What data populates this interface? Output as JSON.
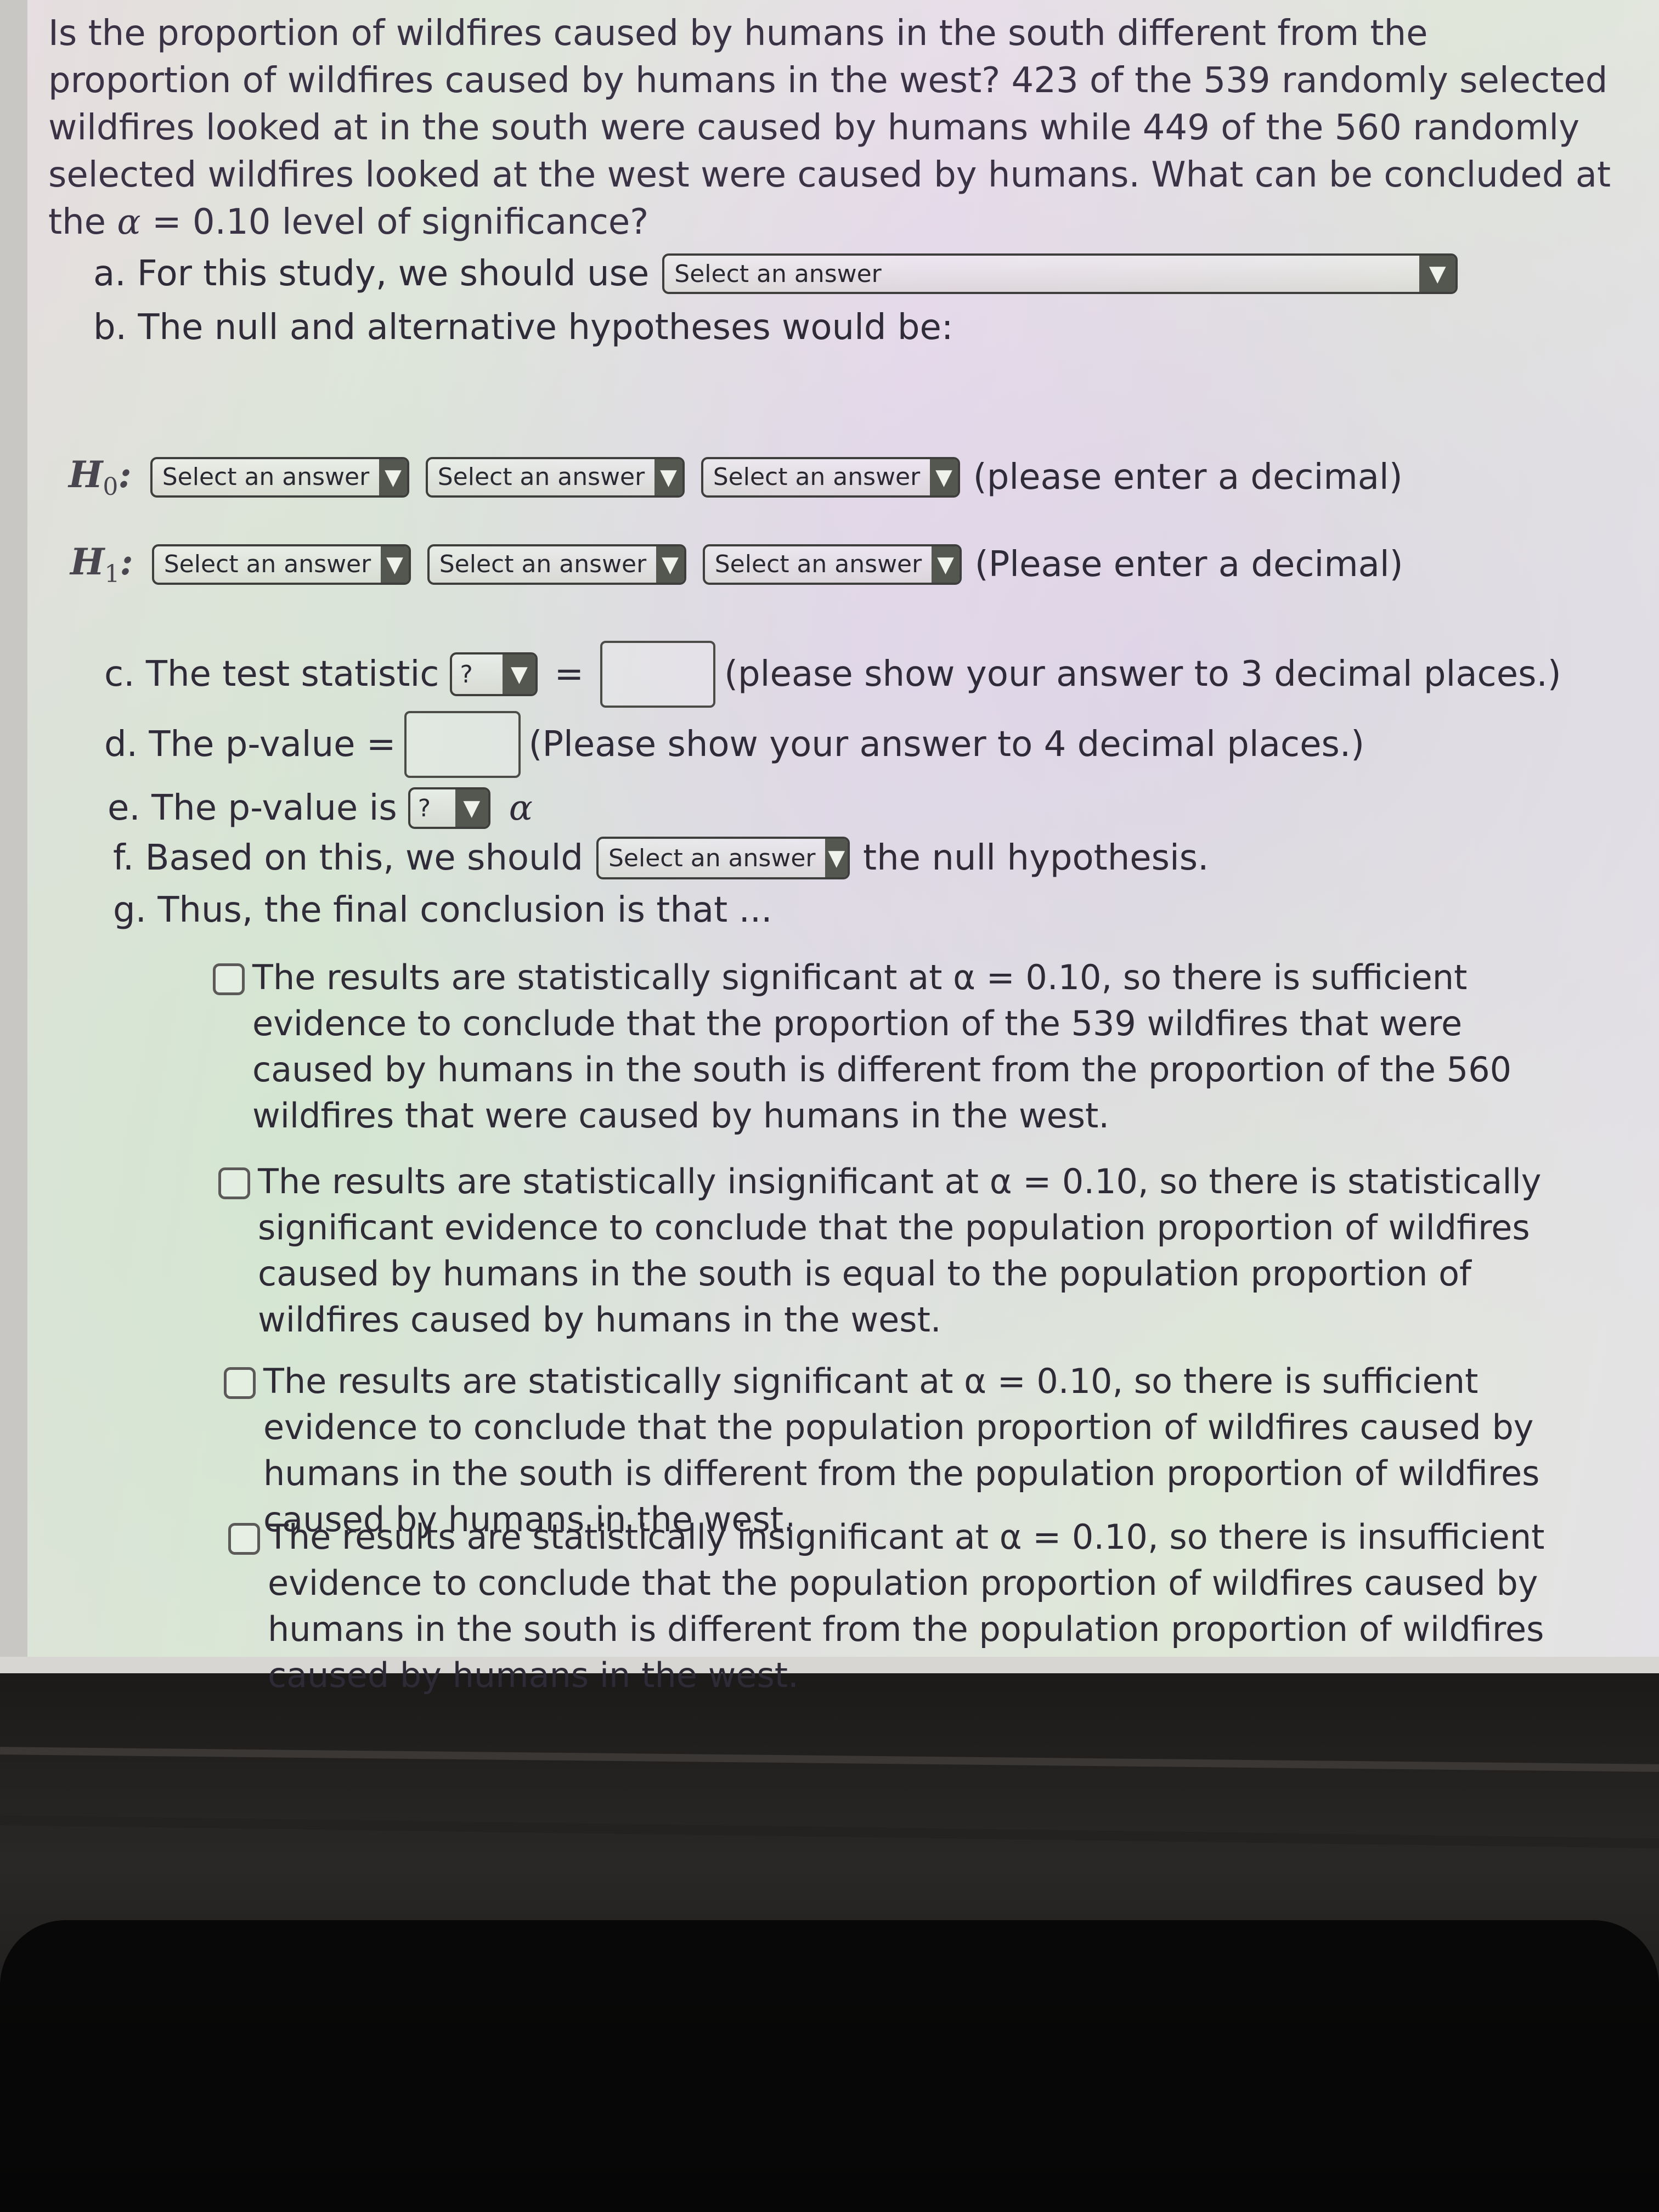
{
  "question": {
    "text_before_alpha": "Is the proportion of wildfires caused by humans in the south different from the proportion of wildfires caused by humans in the west? 423 of the 539 randomly selected wildfires looked at in the south were caused by humans while 449 of the 560 randomly selected wildfires looked at the west were caused by humans. What can be concluded at the ",
    "alpha_symbol": "α",
    "text_after_alpha": " = 0.10 level of significance?"
  },
  "part_a": {
    "label": "a.  For this study, we should use",
    "select": "Select an answer",
    "arrow": "▼"
  },
  "part_b": {
    "label": "b.  The null and alternative hypotheses would be:"
  },
  "h0": {
    "symbol": "H",
    "sub": "0",
    "colon": ":",
    "selects": [
      "Select an answer",
      "Select an answer",
      "Select an answer"
    ],
    "hint": "(please enter a decimal)"
  },
  "h1": {
    "symbol": "H",
    "sub": "1",
    "colon": ":",
    "selects": [
      "Select an answer",
      "Select an answer",
      "Select an answer"
    ],
    "hint": "(Please enter a decimal)"
  },
  "part_c": {
    "label": "c.  The test statistic",
    "select": "?",
    "equals": "=",
    "input_value": "",
    "hint": "(please show your answer to 3 decimal places.)"
  },
  "part_d": {
    "label": "d.  The p-value =",
    "input_value": "",
    "hint": "(Please show your answer to 4 decimal places.)"
  },
  "part_e": {
    "label": "e.  The p-value is",
    "select": "?",
    "alpha": "α"
  },
  "part_f": {
    "label": "f.  Based on this, we should",
    "select": "Select an answer",
    "suffix": "the null hypothesis."
  },
  "part_g": {
    "label": "g.  Thus, the final conclusion is that ...",
    "options": [
      {
        "checked": false,
        "text": "The results are statistically significant at α = 0.10, so there is sufficient evidence to conclude that the proportion of the 539 wildfires that were caused by humans in the south is different from the proportion of the 560 wildfires that were caused by humans in the west."
      },
      {
        "checked": false,
        "text": "The results are statistically insignificant at α = 0.10, so there is statistically significant evidence to conclude that the population proportion of wildfires caused by humans in the south is equal to the population proportion of wildfires caused by humans in the west."
      },
      {
        "checked": false,
        "text": "The results are statistically significant at α = 0.10, so there is sufficient evidence to conclude that the population proportion of wildfires caused by humans in the south is different from the population proportion of wildfires caused by humans in the west."
      },
      {
        "checked": false,
        "text": "The results are statistically insignificant at α = 0.10, so there is insufficient evidence to conclude that the population proportion of wildfires caused by humans in the south is different from the population proportion of wildfires caused by humans in the west."
      }
    ]
  }
}
